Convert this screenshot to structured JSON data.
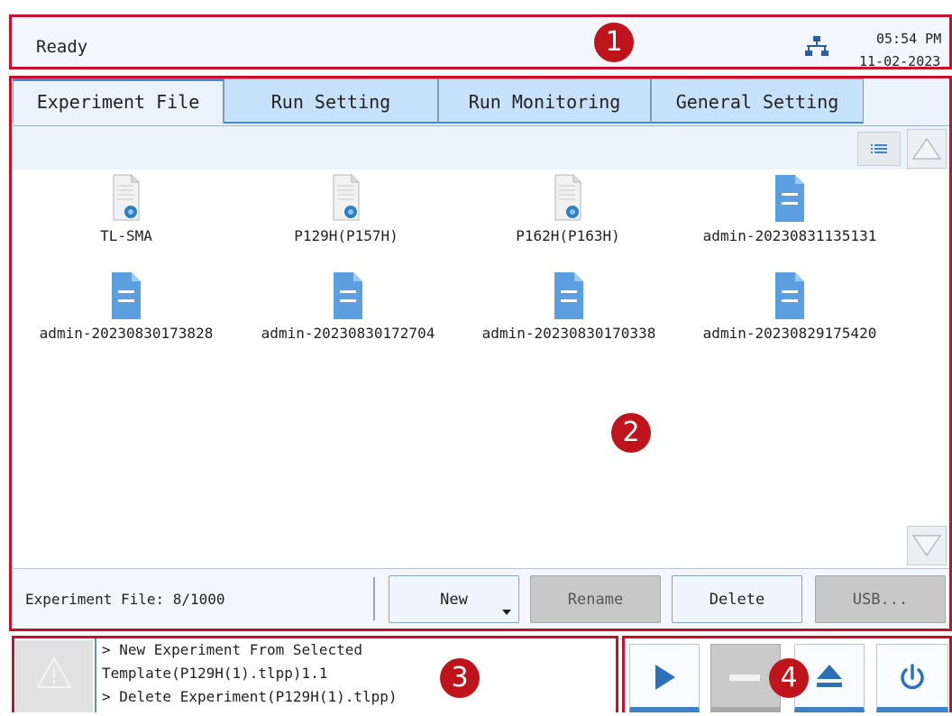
{
  "status_bar": {
    "status_text": "Ready",
    "network_icon": "network-icon",
    "time": "05:54 PM",
    "date": "11-02-2023"
  },
  "tabs": [
    {
      "label": "Experiment File",
      "active": true
    },
    {
      "label": "Run Setting",
      "active": false
    },
    {
      "label": "Run Monitoring",
      "active": false
    },
    {
      "label": "General Setting",
      "active": false
    }
  ],
  "files": [
    {
      "name": "TL-SMA",
      "icon": "template-file-icon"
    },
    {
      "name": "P129H(P157H)",
      "icon": "template-file-icon"
    },
    {
      "name": "P162H(P163H)",
      "icon": "template-file-icon"
    },
    {
      "name": "admin-20230831135131",
      "icon": "document-icon"
    },
    {
      "name": "admin-20230830173828",
      "icon": "document-icon"
    },
    {
      "name": "admin-20230830172704",
      "icon": "document-icon"
    },
    {
      "name": "admin-20230830170338",
      "icon": "document-icon"
    },
    {
      "name": "admin-20230829175420",
      "icon": "document-icon"
    }
  ],
  "footer": {
    "file_count": "Experiment File: 8/1000",
    "new_label": "New",
    "rename_label": "Rename",
    "delete_label": "Delete",
    "usb_label": "USB..."
  },
  "messages": [
    "> New Experiment From Selected",
    "Template(P129H(1).tlpp)1.1",
    "> Delete Experiment(P129H(1).tlpp)"
  ],
  "controls": [
    {
      "icon": "play-icon",
      "enabled": true
    },
    {
      "icon": "stop-icon",
      "enabled": false
    },
    {
      "icon": "eject-icon",
      "enabled": true
    },
    {
      "icon": "power-icon",
      "enabled": true
    }
  ],
  "callouts": [
    "1",
    "2",
    "3",
    "4"
  ],
  "colors": {
    "accent": "#3d82c6",
    "tab_bg": "#c7e2f8",
    "callout": "#c0141c"
  }
}
